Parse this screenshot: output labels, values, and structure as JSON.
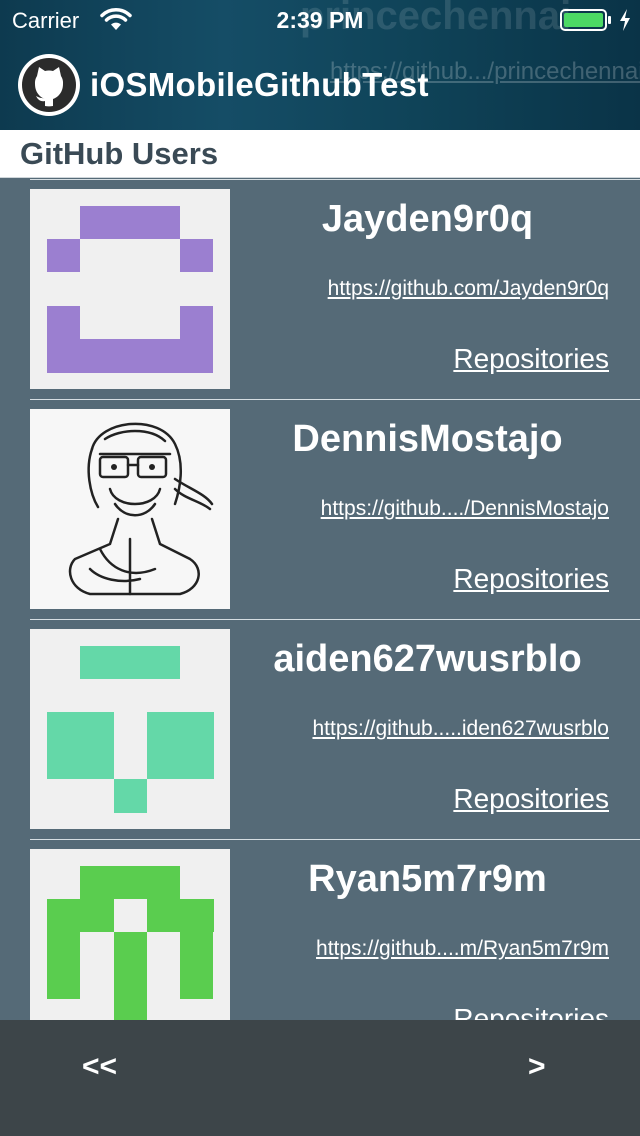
{
  "status_bar": {
    "carrier": "Carrier",
    "time": "2:39 PM",
    "battery_color": "#4cd964"
  },
  "header": {
    "title": "iOSMobileGithubTest",
    "background_text": "princechennai",
    "background_link": "https://github.../princechennai"
  },
  "section": {
    "title": "GitHub Users"
  },
  "users": [
    {
      "name": "Jayden9r0q",
      "url": "https://github.com/Jayden9r0q",
      "repos_label": "Repositories",
      "avatar": "identicon-purple",
      "avatar_color": "#9b7fd0"
    },
    {
      "name": "DennisMostajo",
      "url": "https://github..../DennisMostajo",
      "repos_label": "Repositories",
      "avatar": "sketch-portrait",
      "avatar_color": "#222222"
    },
    {
      "name": "aiden627wusrblo",
      "url": "https://github.....iden627wusrblo",
      "repos_label": "Repositories",
      "avatar": "identicon-teal",
      "avatar_color": "#64d8a8"
    },
    {
      "name": "Ryan5m7r9m",
      "url": "https://github....m/Ryan5m7r9m",
      "repos_label": "Repositories",
      "avatar": "identicon-green",
      "avatar_color": "#5acd4f"
    }
  ],
  "pagination": {
    "prev_label": "<<",
    "next_label": ">"
  }
}
